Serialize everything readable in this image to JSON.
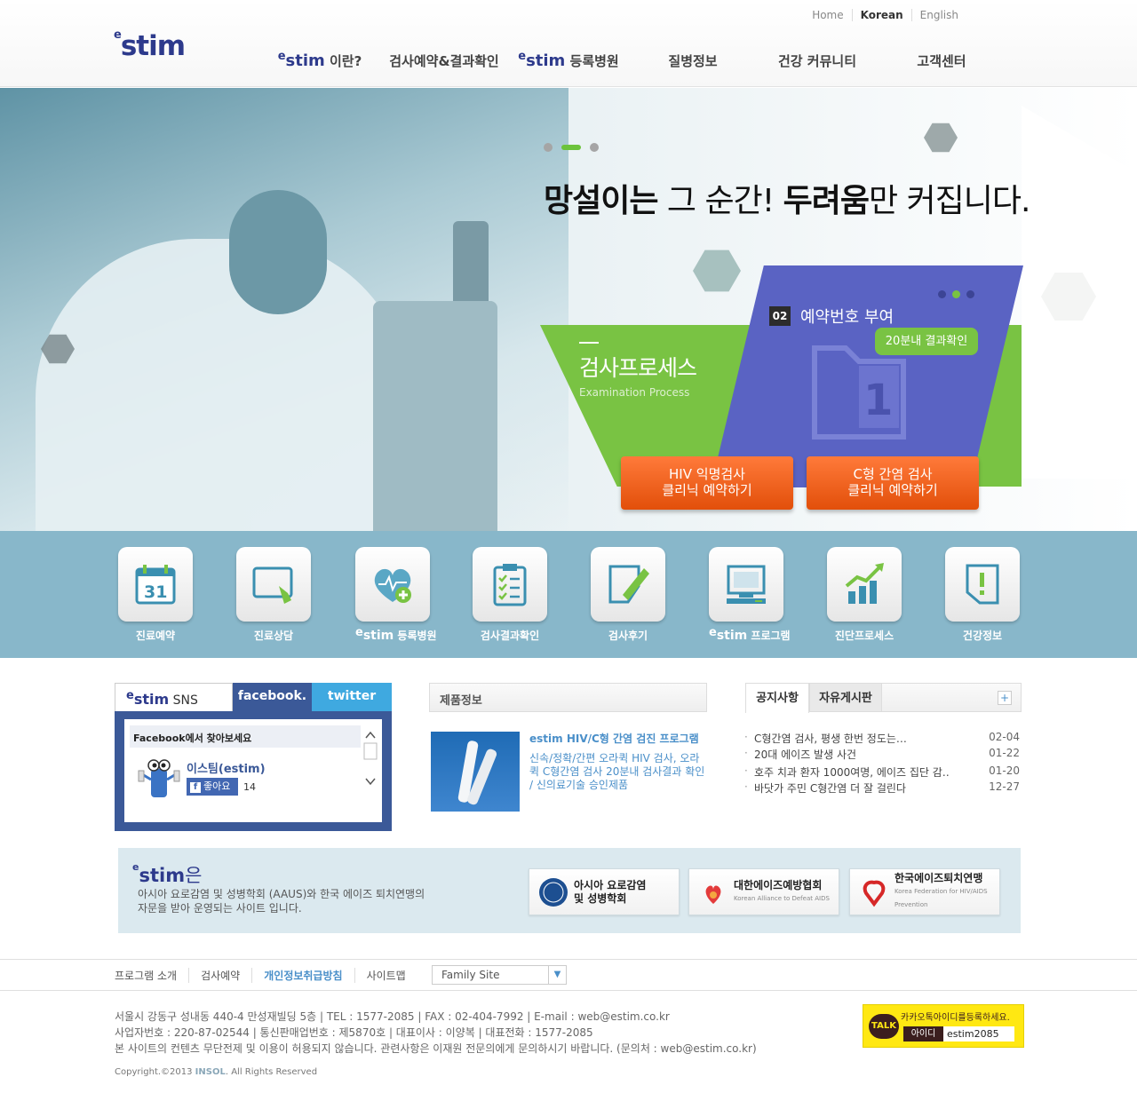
{
  "header": {
    "logo_sup": "e",
    "logo_text": "stim",
    "top_links": [
      "Home",
      "Korean",
      "English"
    ],
    "gnb": [
      {
        "sup": "e",
        "brand": "stim",
        "label": " 이란?"
      },
      {
        "label": "검사예약&결과확인"
      },
      {
        "sup": "e",
        "brand": "stim",
        "label": " 등록병원"
      },
      {
        "label": "질병정보"
      },
      {
        "label": "건강 커뮤니티"
      },
      {
        "label": "고객센터"
      }
    ]
  },
  "hero": {
    "headline_bold1": "망설이는",
    "headline_part2": " 그 순간! ",
    "headline_bold2": "두려움",
    "headline_part3": "만 커집니다.",
    "process_title": "검사프로세스",
    "process_subtitle": "Examination Process",
    "step_number": "02",
    "step_title": "예약번호 부여",
    "step_badge": "20분내 결과확인",
    "btn_hiv_line1": "HIV 익명검사",
    "btn_hiv_line2": "클리닉 예약하기",
    "btn_hcv_line1": "C형 간염 검사",
    "btn_hcv_line2": "클리닉 예약하기",
    "colors": {
      "green": "#79c343",
      "blue": "#5a63c3",
      "orange": "#f0601a"
    }
  },
  "quick_menu": [
    {
      "label": "진료예약",
      "icon": "calendar-icon",
      "calendar_day": "31"
    },
    {
      "label": "진료상담",
      "icon": "monitor-hand-icon"
    },
    {
      "sup": "e",
      "brand": "stim",
      "label": " 등록병원",
      "icon": "heart-plus-icon"
    },
    {
      "label": "검사결과확인",
      "icon": "clipboard-check-icon"
    },
    {
      "label": "검사후기",
      "icon": "pencil-note-icon"
    },
    {
      "sup": "e",
      "brand": "stim",
      "label": " 프로그램",
      "icon": "computer-icon"
    },
    {
      "label": "진단프로세스",
      "icon": "growth-chart-icon"
    },
    {
      "label": "건강정보",
      "icon": "exclamation-doc-icon"
    }
  ],
  "sns": {
    "title_sup": "e",
    "title_brand": "stim",
    "title_rest": " SNS",
    "tab_facebook": "facebook.",
    "tab_twitter": "twitter",
    "fb_header": "Facebook에서 찾아보세요",
    "fb_page_name": "이스팀(estim)",
    "fb_like_label": "좋아요",
    "fb_like_count": "14"
  },
  "product": {
    "header": "제품정보",
    "title": "estim HIV/C형 간염 검진 프로그램",
    "description": "신속/정확/간편 오라퀵 HIV 검사, 오라퀵 C형간염 검사 20분내 검사결과 확인 / 신의료기술 승인제품"
  },
  "notice": {
    "tab_notice": "공지사항",
    "tab_free": "자유게시판",
    "more": "+",
    "items": [
      {
        "title": "C형간염 검사, 평생 한번 정도는…",
        "date": "02-04"
      },
      {
        "title": "20대 에이즈 발생 사건",
        "date": "01-22"
      },
      {
        "title": "호주 치과 환자 1000여명, 에이즈 집단 감…",
        "date": "01-20"
      },
      {
        "title": "바닷가 주민 C형간염 더 잘 걸린다",
        "date": "12-27"
      }
    ]
  },
  "advisory": {
    "title_sup": "e",
    "title_brand": "stim",
    "title_rest": "은",
    "text_line1": "아시아 요로감염 및 성병학회 (AAUS)와 한국 에이즈 퇴치연맹의",
    "text_line2": "자문을 받아 운영되는 사이트 입니다.",
    "orgs": [
      {
        "name_line1": "아시아 요로감염",
        "name_line2": "및 성병학회",
        "icon": "aaus-logo-icon"
      },
      {
        "name_line1": "대한에이즈예방협회",
        "name_line2": "Korean Alliance to Defeat AIDS",
        "icon": "kaap-logo-icon"
      },
      {
        "name_line1": "한국에이즈퇴치연맹",
        "name_line2": "Korea Federation for HIV/AIDS Prevention",
        "icon": "kfap-logo-icon"
      }
    ]
  },
  "footer": {
    "nav": [
      "프로그램 소개",
      "검사예약",
      "개인정보취급방침",
      "사이트맵"
    ],
    "family_site": "Family Site",
    "info_line1": "서울시 강동구 성내동 440-4 만성재빌딩 5층 | TEL : 1577-2085 | FAX : 02-404-7992 | E-mail : web@estim.co.kr",
    "info_line2": "사업자번호 : 220-87-02544 | 통신판매업번호 : 제5870호 | 대표이사 : 이양복 | 대표전화 : 1577-2085",
    "info_line3": "본 사이트의 컨텐츠 무단전제 및 이용이 허용되지 않습니다. 관련사항은 이재원 전문의에게 문의하시기 바랍니다. (문의처 : web@estim.co.kr)",
    "copyright_pre": "Copyright.©2013 ",
    "copyright_brand": "INSOL",
    "copyright_post": ". All Rights Reserved",
    "kakao_badge": "TALK",
    "kakao_msg": "카카오톡아이디를등록하세요.",
    "kakao_id_label": "아이디",
    "kakao_id_value": "estim2085"
  }
}
